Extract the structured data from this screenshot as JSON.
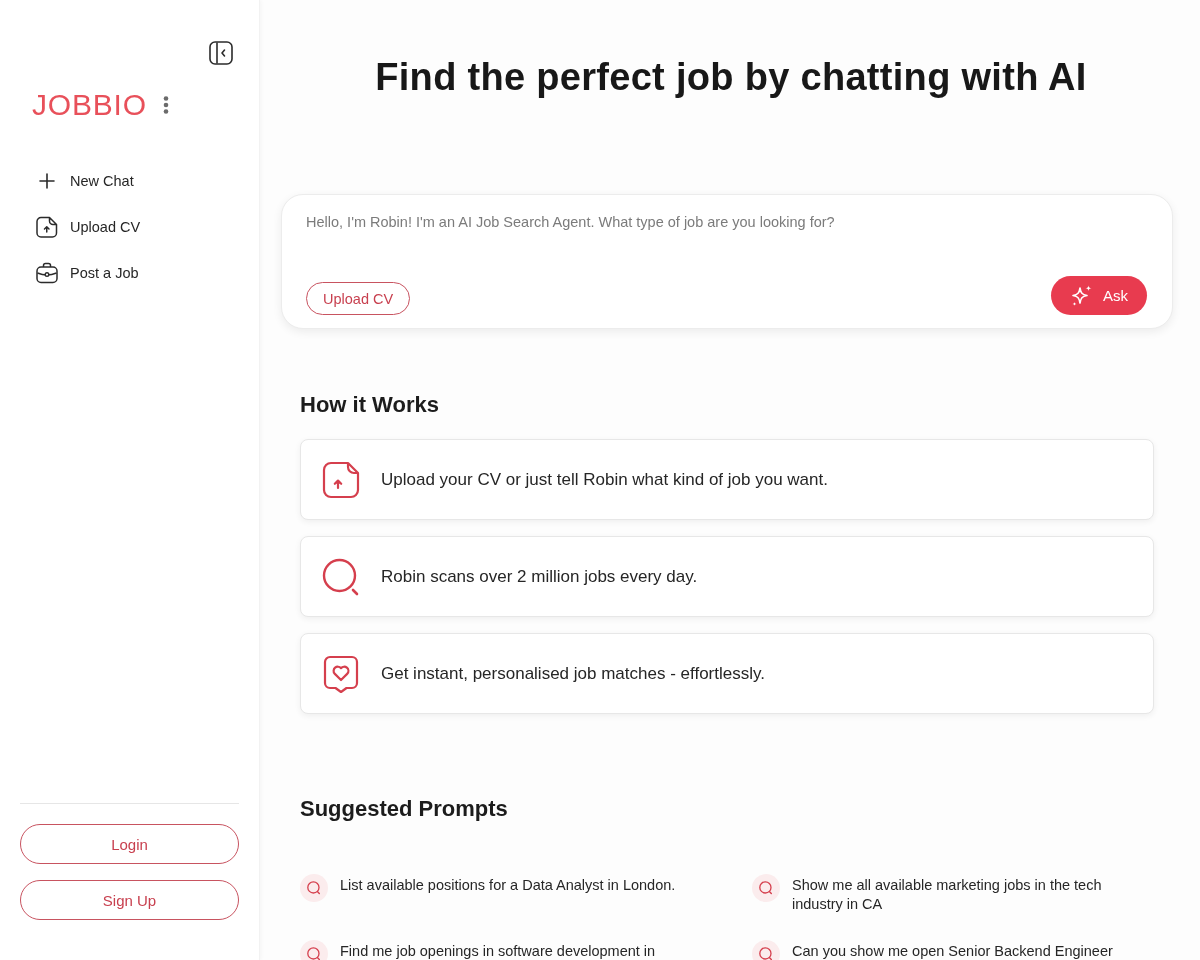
{
  "sidebar": {
    "brand": "JOBBIO",
    "nav": [
      {
        "kind": "new",
        "label": "New Chat"
      },
      {
        "kind": "upload",
        "label": "Upload CV"
      },
      {
        "kind": "job",
        "label": "Post a Job"
      }
    ],
    "auth_buttons": [
      "Login",
      "Sign Up"
    ]
  },
  "title": "Find the perfect job by chatting with AI",
  "chat": {
    "placeholder": "Hello, I'm Robin! I'm an AI Job Search Agent. What type of job are you looking for?",
    "upload_button": "Upload CV",
    "ask_button": "Ask"
  },
  "how_it_works": {
    "heading": "How it Works",
    "steps": [
      {
        "kind": "upload",
        "text": "Upload your CV or just tell Robin what kind of job you want."
      },
      {
        "kind": "search",
        "text": "Robin scans over 2 million jobs every day."
      },
      {
        "kind": "match",
        "text": "Get instant, personalised job matches - effortlessly."
      }
    ]
  },
  "suggested_prompts": {
    "heading": "Suggested Prompts",
    "prompts": [
      "List available positions for a Data Analyst in London.",
      "Show me all available marketing jobs in the tech industry in CA",
      "Find me job openings in software development in",
      "Can you show me open Senior Backend Engineer"
    ]
  }
}
